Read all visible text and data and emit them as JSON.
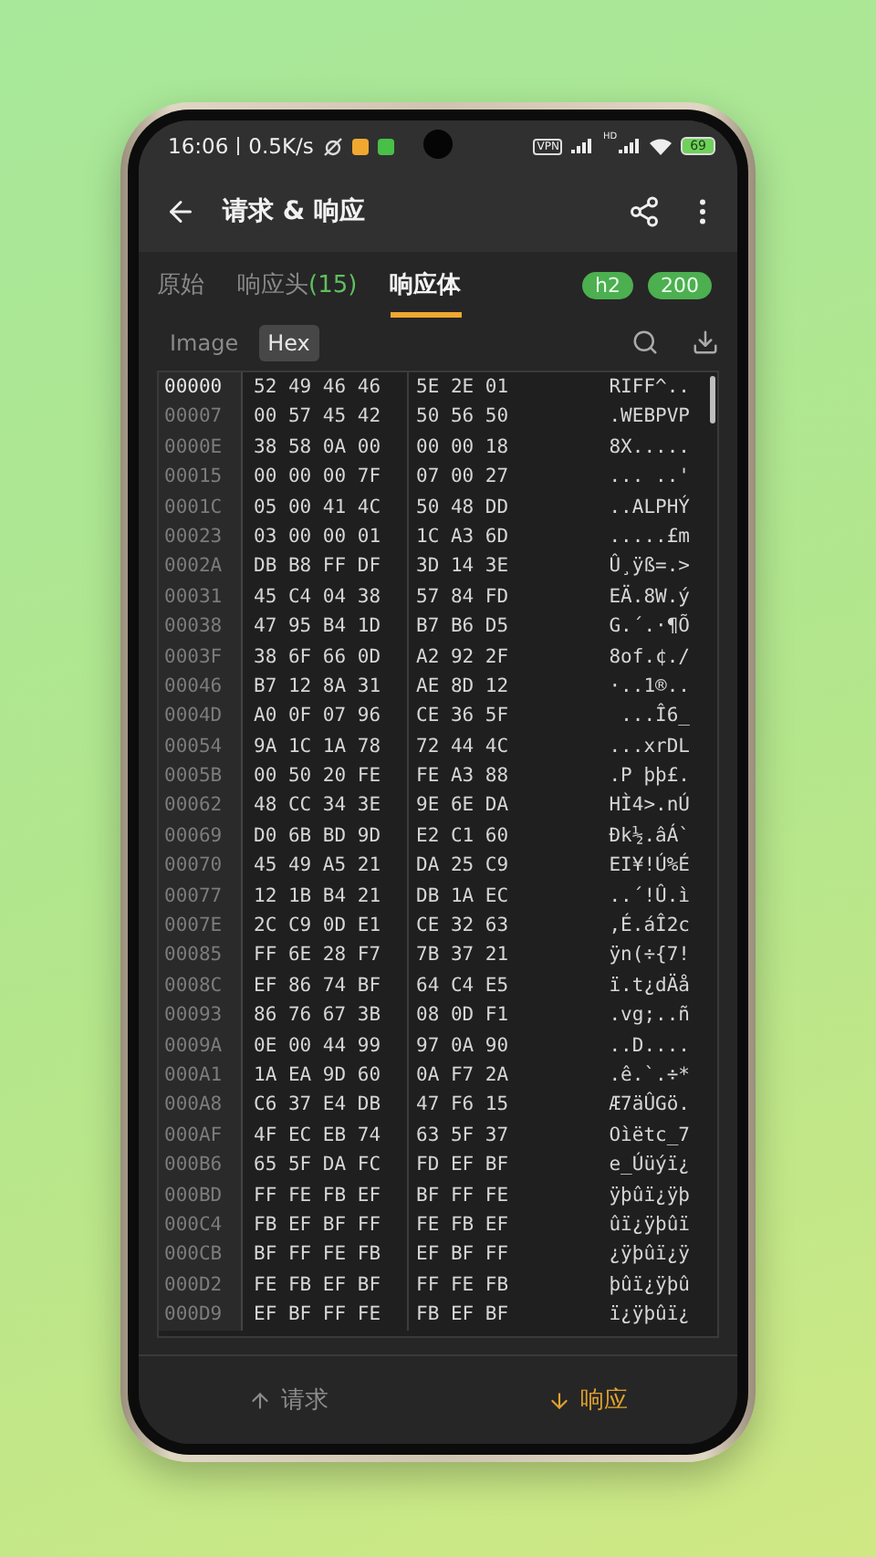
{
  "status_bar": {
    "time": "16:06",
    "speed": "0.5K/s",
    "vpn": "VPN",
    "hd": "HD",
    "battery": "69"
  },
  "app_bar": {
    "title": "请求 & 响应"
  },
  "tabs": [
    {
      "label": "原始",
      "selected": false
    },
    {
      "label": "响应头",
      "count": "(15)",
      "selected": false
    },
    {
      "label": "响应体",
      "selected": true
    }
  ],
  "badges": [
    "h2",
    "200"
  ],
  "view_modes": [
    {
      "label": "Image",
      "selected": false
    },
    {
      "label": "Hex",
      "selected": true
    }
  ],
  "hex_rows": [
    {
      "address": "00000",
      "hex": [
        "52 49 46 46",
        "5E 2E 01"
      ],
      "ascii": "RIFF^..",
      "selected": true
    },
    {
      "address": "00007",
      "hex": [
        "00 57 45 42",
        "50 56 50"
      ],
      "ascii": ".WEBPVP",
      "selected": false
    },
    {
      "address": "0000E",
      "hex": [
        "38 58 0A 00",
        "00 00 18"
      ],
      "ascii": "8X.....",
      "selected": false
    },
    {
      "address": "00015",
      "hex": [
        "00 00 00 7F",
        "07 00 27"
      ],
      "ascii": "... ..'",
      "selected": false
    },
    {
      "address": "0001C",
      "hex": [
        "05 00 41 4C",
        "50 48 DD"
      ],
      "ascii": "..ALPHÝ",
      "selected": false
    },
    {
      "address": "00023",
      "hex": [
        "03 00 00 01",
        "1C A3 6D"
      ],
      "ascii": ".....£m",
      "selected": false
    },
    {
      "address": "0002A",
      "hex": [
        "DB B8 FF DF",
        "3D 14 3E"
      ],
      "ascii": "Û¸ÿß=.>",
      "selected": false
    },
    {
      "address": "00031",
      "hex": [
        "45 C4 04 38",
        "57 84 FD"
      ],
      "ascii": "EÄ.8W.ý",
      "selected": false
    },
    {
      "address": "00038",
      "hex": [
        "47 95 B4 1D",
        "B7 B6 D5"
      ],
      "ascii": "G.´.·¶Õ",
      "selected": false
    },
    {
      "address": "0003F",
      "hex": [
        "38 6F 66 0D",
        "A2 92 2F"
      ],
      "ascii": "8of.¢./",
      "selected": false
    },
    {
      "address": "00046",
      "hex": [
        "B7 12 8A 31",
        "AE 8D 12"
      ],
      "ascii": "·..1®..",
      "selected": false
    },
    {
      "address": "0004D",
      "hex": [
        "A0 0F 07 96",
        "CE 36 5F"
      ],
      "ascii": "...Î6_",
      "selected": false
    },
    {
      "address": "00054",
      "hex": [
        "9A 1C 1A 78",
        "72 44 4C"
      ],
      "ascii": "...xrDL",
      "selected": false
    },
    {
      "address": "0005B",
      "hex": [
        "00 50 20 FE",
        "FE A3 88"
      ],
      "ascii": ".P þþ£.",
      "selected": false
    },
    {
      "address": "00062",
      "hex": [
        "48 CC 34 3E",
        "9E 6E DA"
      ],
      "ascii": "HÌ4>.nÚ",
      "selected": false
    },
    {
      "address": "00069",
      "hex": [
        "D0 6B BD 9D",
        "E2 C1 60"
      ],
      "ascii": "Ðk½.âÁ`",
      "selected": false
    },
    {
      "address": "00070",
      "hex": [
        "45 49 A5 21",
        "DA 25 C9"
      ],
      "ascii": "EI¥!Ú%É",
      "selected": false
    },
    {
      "address": "00077",
      "hex": [
        "12 1B B4 21",
        "DB 1A EC"
      ],
      "ascii": "..´!Û.ì",
      "selected": false
    },
    {
      "address": "0007E",
      "hex": [
        "2C C9 0D E1",
        "CE 32 63"
      ],
      "ascii": ",É.áÎ2c",
      "selected": false
    },
    {
      "address": "00085",
      "hex": [
        "FF 6E 28 F7",
        "7B 37 21"
      ],
      "ascii": "ÿn(÷{7!",
      "selected": false
    },
    {
      "address": "0008C",
      "hex": [
        "EF 86 74 BF",
        "64 C4 E5"
      ],
      "ascii": "ï.t¿dÄå",
      "selected": false
    },
    {
      "address": "00093",
      "hex": [
        "86 76 67 3B",
        "08 0D F1"
      ],
      "ascii": ".vg;..ñ",
      "selected": false
    },
    {
      "address": "0009A",
      "hex": [
        "0E 00 44 99",
        "97 0A 90"
      ],
      "ascii": "..D....",
      "selected": false
    },
    {
      "address": "000A1",
      "hex": [
        "1A EA 9D 60",
        "0A F7 2A"
      ],
      "ascii": ".ê.`.÷*",
      "selected": false
    },
    {
      "address": "000A8",
      "hex": [
        "C6 37 E4 DB",
        "47 F6 15"
      ],
      "ascii": "Æ7äÛGö.",
      "selected": false
    },
    {
      "address": "000AF",
      "hex": [
        "4F EC EB 74",
        "63 5F 37"
      ],
      "ascii": "Oìëtc_7",
      "selected": false
    },
    {
      "address": "000B6",
      "hex": [
        "65 5F DA FC",
        "FD EF BF"
      ],
      "ascii": "e_Úüýï¿",
      "selected": false
    },
    {
      "address": "000BD",
      "hex": [
        "FF FE FB EF",
        "BF FF FE"
      ],
      "ascii": "ÿþûï¿ÿþ",
      "selected": false
    },
    {
      "address": "000C4",
      "hex": [
        "FB EF BF FF",
        "FE FB EF"
      ],
      "ascii": "ûï¿ÿþûï",
      "selected": false
    },
    {
      "address": "000CB",
      "hex": [
        "BF FF FE FB",
        "EF BF FF"
      ],
      "ascii": "¿ÿþûï¿ÿ",
      "selected": false
    },
    {
      "address": "000D2",
      "hex": [
        "FE FB EF BF",
        "FF FE FB"
      ],
      "ascii": "þûï¿ÿþû",
      "selected": false
    },
    {
      "address": "000D9",
      "hex": [
        "EF BF FF FE",
        "FB EF BF"
      ],
      "ascii": "ï¿ÿþûï¿",
      "selected": false
    }
  ],
  "bottom_nav": [
    {
      "label": "请求",
      "kind": "up",
      "selected": false
    },
    {
      "label": "响应",
      "kind": "down",
      "selected": true
    }
  ]
}
